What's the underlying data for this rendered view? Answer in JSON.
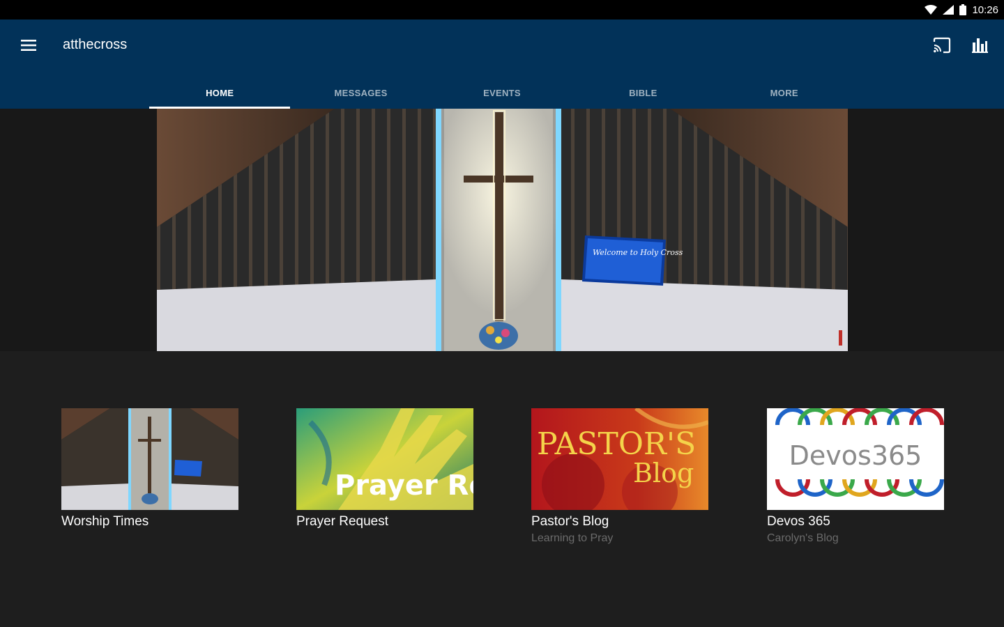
{
  "status_bar": {
    "time": "10:26",
    "icons": [
      "wifi-icon",
      "signal-icon",
      "battery-icon"
    ]
  },
  "app_bar": {
    "title": "atthecross",
    "menu_icon": "hamburger-menu-icon",
    "actions": [
      "cast-icon",
      "stats-chart-icon"
    ]
  },
  "tabs": [
    {
      "label": "HOME",
      "active": true
    },
    {
      "label": "MESSAGES",
      "active": false
    },
    {
      "label": "EVENTS",
      "active": false
    },
    {
      "label": "BIBLE",
      "active": false
    },
    {
      "label": "MORE",
      "active": false
    }
  ],
  "hero": {
    "screen_text": "Welcome to Holy Cross"
  },
  "cards": [
    {
      "title": "Worship Times",
      "subtitle": ""
    },
    {
      "title": "Prayer Request",
      "subtitle": "",
      "image_text": "Prayer Request"
    },
    {
      "title": "Pastor's Blog",
      "subtitle": "Learning to Pray",
      "image_text_1": "PASTOR'S",
      "image_text_2": "Blog"
    },
    {
      "title": "Devos 365",
      "subtitle": "Carolyn's Blog",
      "image_text": "Devos365"
    }
  ],
  "colors": {
    "app_bar": "#023259",
    "status_bar": "#000000",
    "background": "#1e1e1e",
    "tab_indicator": "#ffffff"
  }
}
